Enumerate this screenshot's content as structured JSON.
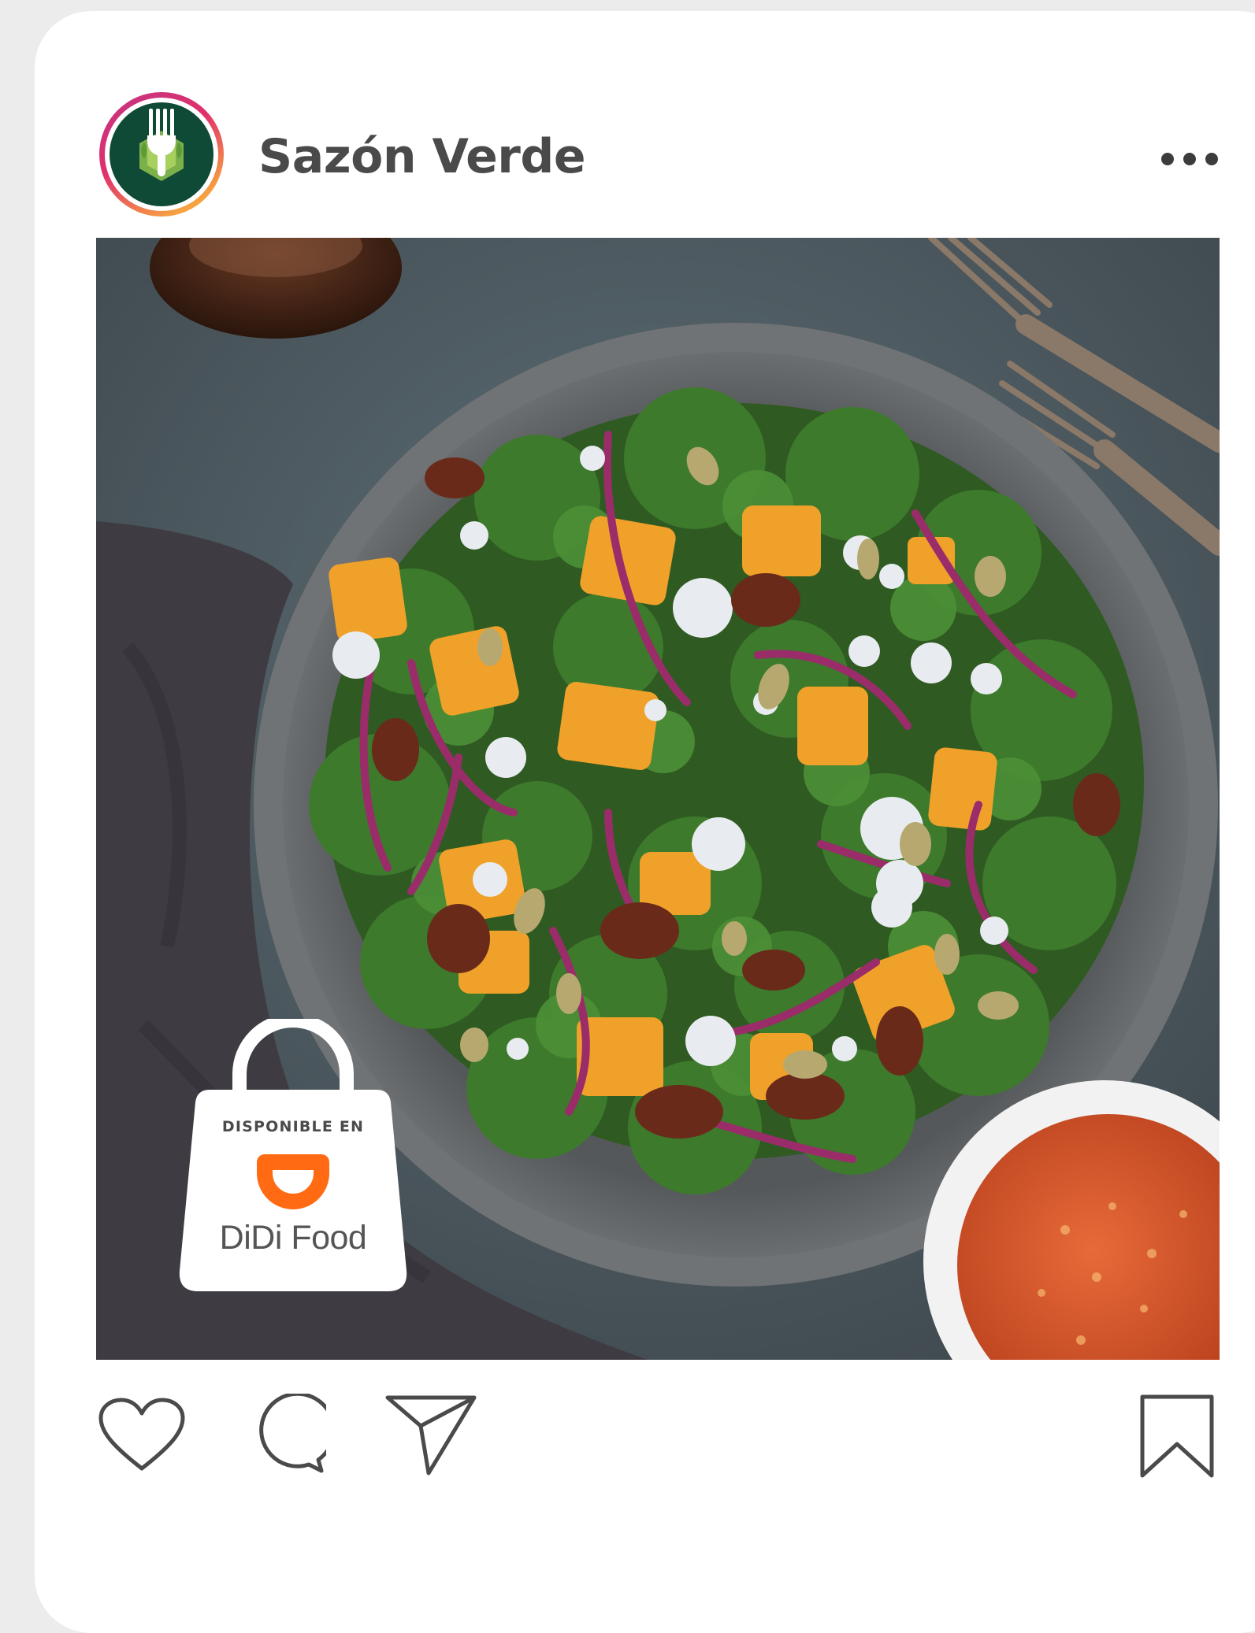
{
  "post": {
    "account_name": "Sazón Verde",
    "more_icon": "more-horizontal-icon",
    "image_subject": "food-photo"
  },
  "badge": {
    "label": "DISPONIBLE EN",
    "brand": "DiDi Food",
    "brand_color": "#ff6a13",
    "icon": "shopping-bag-icon"
  },
  "actions": {
    "like_icon": "heart-icon",
    "comment_icon": "comment-icon",
    "share_icon": "send-icon",
    "save_icon": "bookmark-icon"
  },
  "colors": {
    "avatar_ring_start": "#c13584",
    "avatar_ring_end": "#f7a440",
    "avatar_fill": "#0e4a36",
    "icon_stroke": "#4a4a4a"
  }
}
